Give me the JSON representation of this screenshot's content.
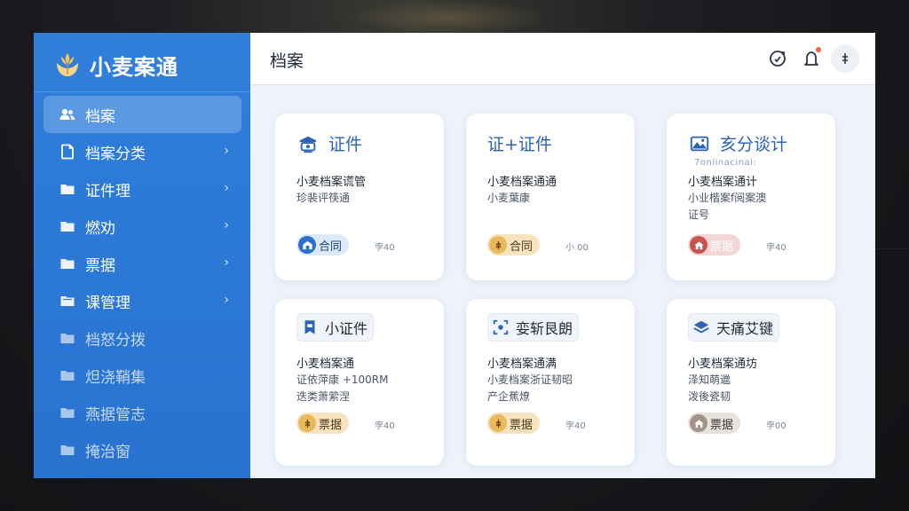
{
  "app": {
    "name": "小麦案通"
  },
  "sidebar": {
    "items": [
      {
        "label": "档案",
        "icon": "users-icon",
        "active": true,
        "chevron": false
      },
      {
        "label": "档案分类",
        "icon": "document-icon",
        "active": false,
        "chevron": true
      },
      {
        "label": "证件理",
        "icon": "folder-icon",
        "active": false,
        "chevron": true
      },
      {
        "label": "燃劝",
        "icon": "folder-icon",
        "active": false,
        "chevron": true
      },
      {
        "label": "票据",
        "icon": "folder-icon",
        "active": false,
        "chevron": true
      },
      {
        "label": "课管理",
        "icon": "folder-open-icon",
        "active": false,
        "chevron": true
      },
      {
        "label": "档怒分拨",
        "icon": "folder-icon",
        "active": false,
        "chevron": false
      },
      {
        "label": "炟浇鞘集",
        "icon": "folder-icon",
        "active": false,
        "chevron": false
      },
      {
        "label": "燕据管志",
        "icon": "folder-icon",
        "active": false,
        "chevron": false
      },
      {
        "label": "掩治窗",
        "icon": "folder-icon",
        "active": false,
        "chevron": false
      }
    ],
    "chevron_glyph": "›"
  },
  "header": {
    "title": "档案",
    "icons": [
      "refresh-icon",
      "notification-icon",
      "more-icon"
    ]
  },
  "cards": [
    {
      "title": "证件",
      "subtitle": "",
      "title_icon": "badge-icon",
      "name": "小麦档案谎管",
      "desc": "珍裴评筷通",
      "tag": "合同",
      "tag_style": "blue",
      "meta": "孛40"
    },
    {
      "title": "证+证件",
      "subtitle": "",
      "title_icon": "",
      "name": "小麦档案通通",
      "desc": "小麦葉康",
      "tag": "合同",
      "tag_style": "gold",
      "meta": "小 00"
    },
    {
      "title": "亥分谈计",
      "subtitle": "7onlinacinal:",
      "title_icon": "landscape-icon",
      "name": "小麦档案通计",
      "desc": "小业楷案f阅案澳\n证号",
      "tag": "票据",
      "tag_style": "red",
      "meta": "孛40"
    },
    {
      "title": "小证件",
      "subtitle": "",
      "title_icon": "bookmark-icon",
      "name": "小麦档案通",
      "desc": "证依萍康 +100RM\n迭类萧萦涅",
      "tag": "票据",
      "tag_style": "gold",
      "meta": "孛40"
    },
    {
      "title": "娈斩艮朗",
      "subtitle": "",
      "title_icon": "scan-icon",
      "name": "小麦档案通满",
      "desc": "小麦档案浙证韧昭\n产企蕉燎",
      "tag": "票据",
      "tag_style": "gold",
      "meta": "孛40"
    },
    {
      "title": "天痛艾键",
      "subtitle": "",
      "title_icon": "layers-icon",
      "name": "小麦档案通坊",
      "desc": "泽知萌邋\n泼後瓷韧",
      "tag": "票据",
      "tag_style": "grey",
      "meta": "孛00"
    }
  ],
  "colors": {
    "sidebar": "#2b78d6",
    "accent": "#2c63b5",
    "page_bg": "#eef3fb",
    "notification_dot": "#f0643c"
  }
}
